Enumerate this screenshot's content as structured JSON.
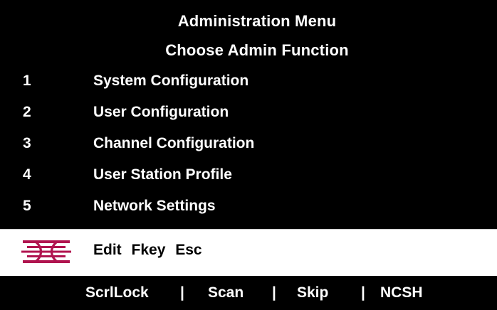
{
  "header": {
    "title": "Administration Menu",
    "subtitle": "Choose Admin Function"
  },
  "menu": {
    "items": [
      {
        "number": "1",
        "label": "System Configuration"
      },
      {
        "number": "2",
        "label": "User Configuration"
      },
      {
        "number": "3",
        "label": "Channel Configuration"
      },
      {
        "number": "4",
        "label": "User Station Profile"
      },
      {
        "number": "5",
        "label": "Network Settings"
      }
    ]
  },
  "edit_bar": {
    "logo_icon": "brand-logo-icon",
    "keys": [
      "Edit",
      "Fkey",
      "Esc"
    ]
  },
  "status_bar": {
    "items": [
      "ScrlLock",
      "Scan",
      "Skip",
      "NCSH"
    ],
    "separator": "|"
  },
  "colors": {
    "background": "#000000",
    "text": "#ffffff",
    "edit_bar_background": "#ffffff",
    "logo": "#b0144f"
  }
}
